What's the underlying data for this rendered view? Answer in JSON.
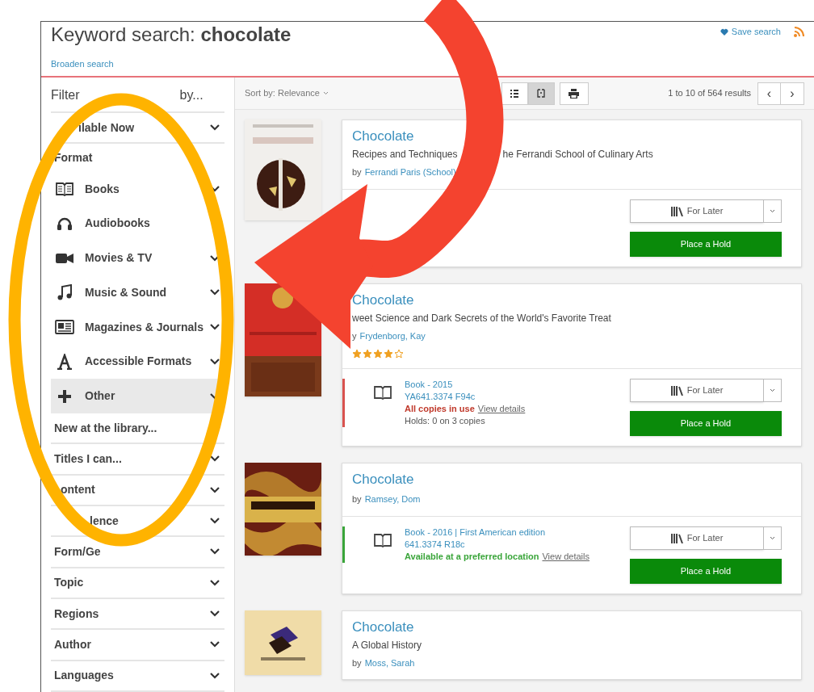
{
  "header": {
    "title_prefix": "Keyword search:",
    "query": "chocolate",
    "save_search": "Save search",
    "broaden": "Broaden search"
  },
  "sidebar": {
    "heading": [
      "Filter",
      "by..."
    ],
    "items": [
      {
        "kind": "section",
        "label": "ilable Now",
        "lead_gap": true,
        "collapsible": true,
        "highlighted": false
      },
      {
        "kind": "label",
        "label": "Format"
      },
      {
        "kind": "format",
        "label": "Books",
        "collapsible": true,
        "highlighted": false
      },
      {
        "kind": "format",
        "label": "Audiobooks",
        "highlighted": false
      },
      {
        "kind": "format",
        "label": "Movies & TV",
        "collapsible": true,
        "highlighted": false
      },
      {
        "kind": "format",
        "label": "Music & Sound",
        "collapsible": true,
        "highlighted": false
      },
      {
        "kind": "format",
        "label": "Magazines & Journals",
        "collapsible": true,
        "highlighted": false
      },
      {
        "kind": "format",
        "label": "Accessible Formats",
        "collapsible": true,
        "highlighted": false
      },
      {
        "kind": "format",
        "label": "Other",
        "collapsible": true,
        "highlighted": true
      },
      {
        "kind": "section",
        "label": "New at the library...",
        "highlighted": false
      },
      {
        "kind": "section",
        "label": "Titles I can...",
        "collapsible": true,
        "highlighted": false
      },
      {
        "kind": "section",
        "label": "ontent",
        "lead_gap": true,
        "collapsible": true,
        "highlighted": false
      },
      {
        "kind": "section",
        "label": "lence",
        "lead_gap": true,
        "collapsible": true,
        "highlighted": false
      },
      {
        "kind": "section",
        "label": "Form/Ge",
        "collapsible": true,
        "highlighted": false
      },
      {
        "kind": "section",
        "label": "Topic",
        "collapsible": true,
        "highlighted": false
      },
      {
        "kind": "section",
        "label": "Regions",
        "collapsible": true,
        "highlighted": false
      },
      {
        "kind": "section",
        "label": "Author",
        "collapsible": true,
        "highlighted": false
      },
      {
        "kind": "section",
        "label": "Languages",
        "collapsible": true,
        "highlighted": false
      }
    ]
  },
  "toolbar": {
    "sort": "Sort by: Relevance",
    "views": [
      {
        "selected": false
      },
      {
        "selected": true
      }
    ],
    "results": "1 to 10 of 564 results",
    "prev": "‹",
    "next": "›"
  },
  "results": [
    {
      "title": "Chocolate",
      "subtitle": [
        "Recipes and Techniques",
        "he Ferrandi School of Culinary Arts"
      ],
      "by": "by",
      "author": "Ferrandi Paris (School)",
      "for_later": "For Later",
      "hold": "Place a Hold"
    },
    {
      "title": "Chocolate",
      "subtitle": "weet Science and Dark Secrets of the World's Favorite Treat",
      "by": "y",
      "author": "Frydenborg, Kay",
      "stars": 4,
      "format": {
        "line": "Book - 2015",
        "call_number": "YA641.3374 F94c",
        "status": "All copies in use",
        "available": false,
        "details": "View details",
        "holds": "Holds: 0 on 3 copies",
        "color": "#d9534f"
      },
      "for_later": "For Later",
      "hold": "Place a Hold"
    },
    {
      "title": "Chocolate",
      "by": "by",
      "author": "Ramsey, Dom",
      "format": {
        "line": "Book - 2016 | First American edition",
        "call_number": "641.3374 R18c",
        "status": "Available at a preferred location",
        "available": true,
        "details": "View details",
        "color": "#3aa53a"
      },
      "for_later": "For Later",
      "hold": "Place a Hold"
    },
    {
      "title": "Chocolate",
      "subtitle": "A Global History",
      "by": "by",
      "author": "Moss, Sarah"
    }
  ]
}
